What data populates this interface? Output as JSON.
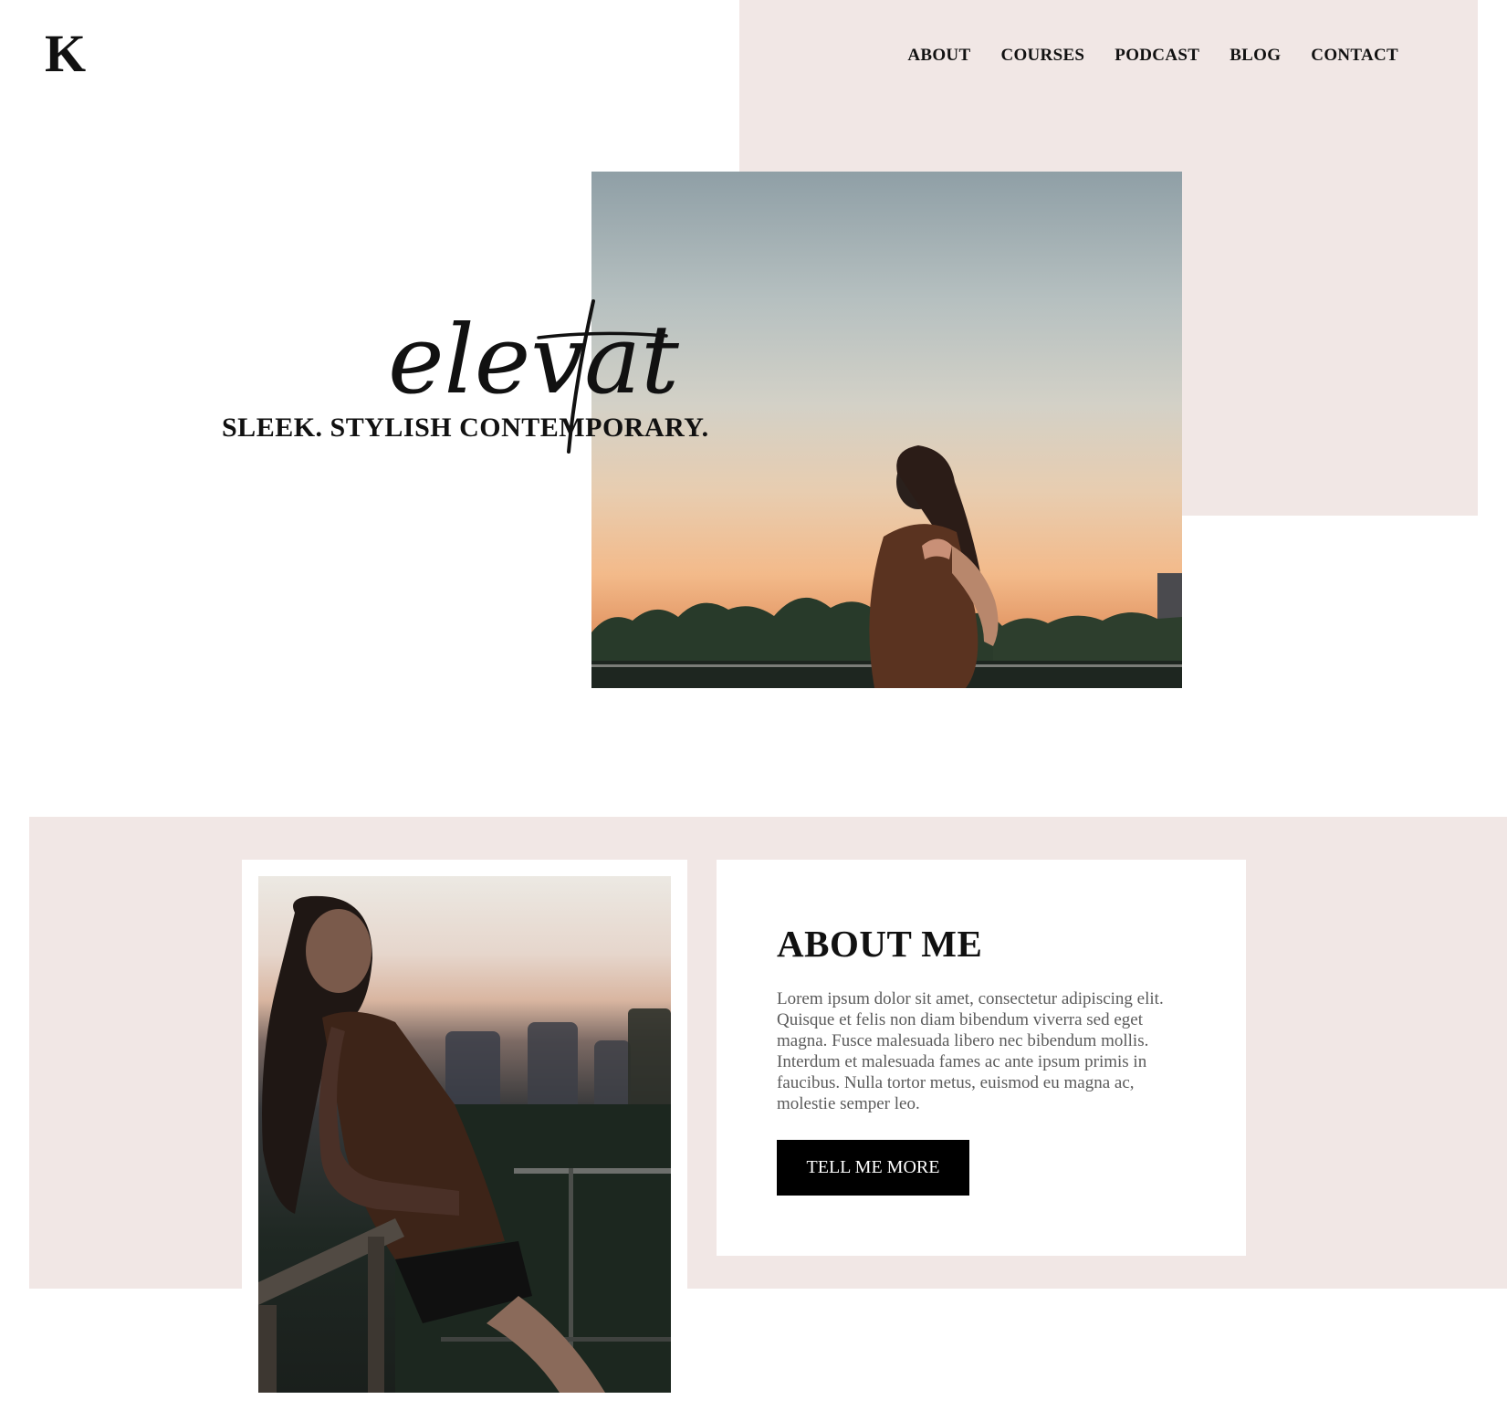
{
  "brand": {
    "logo": "K"
  },
  "nav": {
    "items": [
      {
        "label": "ABOUT"
      },
      {
        "label": "COURSES"
      },
      {
        "label": "PODCAST"
      },
      {
        "label": "BLOG"
      },
      {
        "label": "CONTACT"
      }
    ]
  },
  "hero": {
    "script_word": "elevate",
    "tagline": "SLEEK. STYLISH CONTEMPORARY."
  },
  "about": {
    "title": "ABOUT ME",
    "body": "Lorem ipsum dolor sit amet, consectetur adipiscing elit. Quisque et felis non diam bibendum viverra sed eget magna. Fusce malesuada libero nec bibendum mollis. Interdum et malesuada fames ac ante ipsum primis in faucibus. Nulla tortor metus, euismod eu magna ac, molestie semper leo.",
    "button_label": "TELL ME MORE"
  },
  "colors": {
    "accent_blush": "#f1e7e5",
    "text": "#111111",
    "body_text": "#5b5b5b",
    "button_bg": "#000000",
    "button_text": "#ffffff"
  }
}
